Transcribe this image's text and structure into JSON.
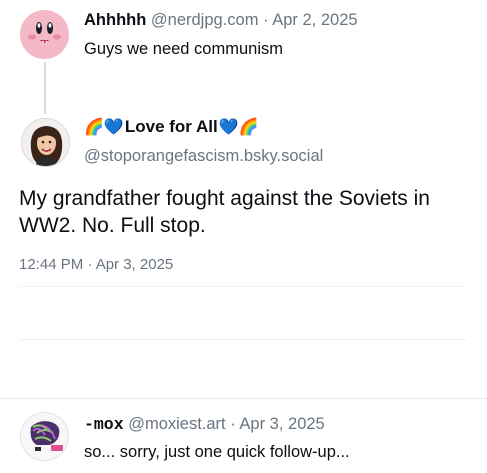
{
  "parent_post": {
    "display_name": "Ahhhhh",
    "handle": "@nerdjpg.com",
    "separator": "·",
    "date": "Apr 2, 2025",
    "text": "Guys we need communism",
    "avatar_icon": "kirby-avatar-icon"
  },
  "main_post": {
    "name_prefix_emoji": "🌈💙",
    "display_name": "Love for All",
    "name_suffix_emoji": "💙🌈",
    "handle": "@stoporangefascism.bsky.social",
    "text": "My grandfather fought against the Soviets in WW2. No. Full stop.",
    "timestamp": "12:44 PM · Apr 3, 2025",
    "avatar_icon": "woman-avatar-icon"
  },
  "reply_post": {
    "display_name": "-mox",
    "handle": "@moxiest.art",
    "separator": "·",
    "date": "Apr 3, 2025",
    "text": "so... sorry, just one quick follow-up...",
    "avatar_icon": "mox-avatar-icon"
  },
  "colors": {
    "text": "#0b0f14",
    "muted": "#6a7582",
    "heart": "#1d8bf0",
    "divider": "#e6eaee"
  }
}
